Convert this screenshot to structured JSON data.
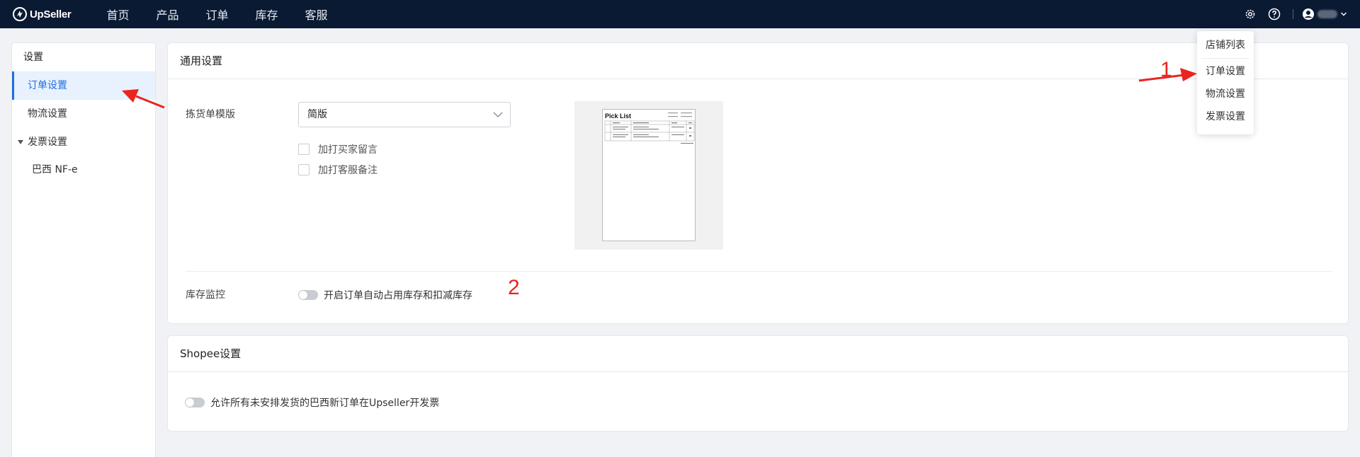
{
  "app": {
    "logo_text": "UpSeller"
  },
  "nav": {
    "items": [
      "首页",
      "产品",
      "订单",
      "库存",
      "客服"
    ]
  },
  "sidebar": {
    "title": "设置",
    "items": [
      "订单设置",
      "物流设置"
    ],
    "group": "发票设置",
    "sub_items": [
      "巴西 NF-e"
    ]
  },
  "general": {
    "title": "通用设置",
    "picklist_label": "拣货单模版",
    "picklist_value": "简版",
    "option_buyer_note": "加打买家留言",
    "option_cs_note": "加打客服备注",
    "preview_title": "Pick List",
    "stock_label": "库存监控",
    "stock_toggle_label": "开启订单自动占用库存和扣减库存"
  },
  "shopee": {
    "title": "Shopee设置",
    "toggle_label": "允许所有未安排发货的巴西新订单在Upseller开发票"
  },
  "dropdown": {
    "items": [
      "店铺列表",
      "订单设置",
      "物流设置",
      "发票设置"
    ]
  },
  "annotations": {
    "num1": "1",
    "num2": "2"
  },
  "colors": {
    "topbar": "#0b1a33",
    "accent": "#1f6fe0",
    "annotation": "#e8251f"
  }
}
